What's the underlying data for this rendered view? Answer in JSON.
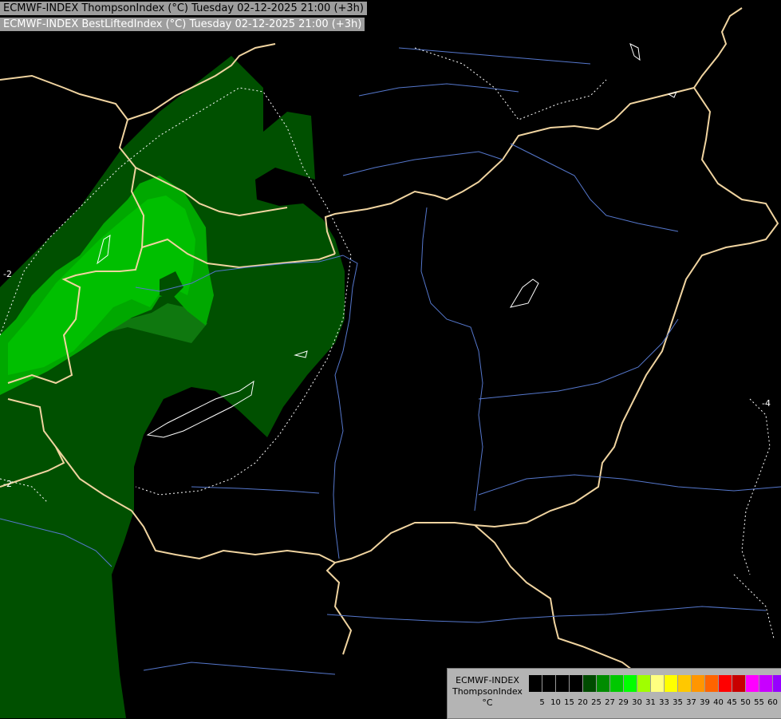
{
  "header": {
    "line1": "ECMWF-INDEX ThompsonIndex (°C) Tuesday 02-12-2025 21:00 (+3h)",
    "line2": "ECMWF-INDEX BestLiftedIndex (°C) Tuesday 02-12-2025 21:00 (+3h)"
  },
  "legend": {
    "source": "ECMWF-INDEX",
    "parameter": "ThompsonIndex",
    "unit": "°C",
    "colors": [
      "#000000",
      "#000000",
      "#000000",
      "#000000",
      "#004b00",
      "#008c00",
      "#00c800",
      "#00ff00",
      "#a0ff00",
      "#ffff80",
      "#ffff00",
      "#ffc800",
      "#ff9600",
      "#ff6400",
      "#ff0000",
      "#c80000",
      "#ff00ff",
      "#c800ff",
      "#9600ff",
      "#6400ff",
      "#0000ff"
    ],
    "ticks": [
      "5",
      "10",
      "15",
      "20",
      "25",
      "27",
      "29",
      "30",
      "31",
      "33",
      "35",
      "37",
      "39",
      "40",
      "45",
      "50",
      "55",
      "60"
    ]
  },
  "contour_labels": {
    "left_upper": "-2",
    "left_lower": "-2",
    "right": "-4"
  },
  "colors": {
    "fill_dark": "#005000",
    "fill_medium": "#0f780f",
    "fill_light": "#00a800",
    "fill_lighter": "#00bf00",
    "border": "#f0d4a0",
    "river": "#5577cc"
  }
}
